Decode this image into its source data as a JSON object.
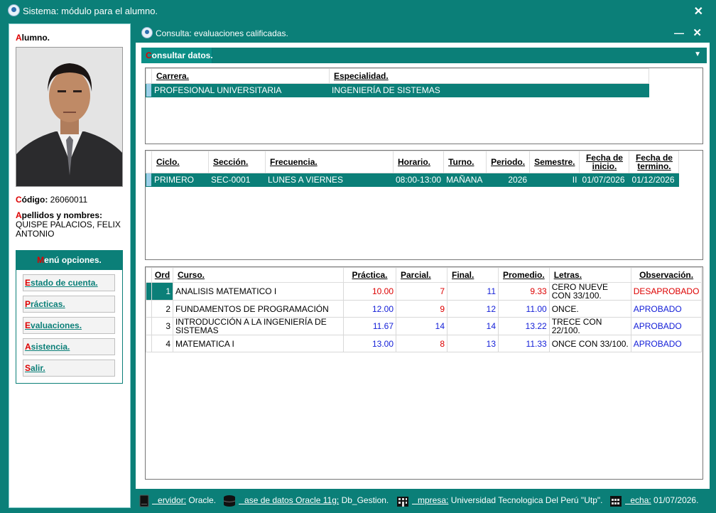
{
  "window": {
    "title": "Sistema: módulo para el alumno.",
    "close": "✕"
  },
  "student": {
    "alumno_label": "Alumno.",
    "codigo_label": "Código:",
    "codigo_value": "26060011",
    "apellidos_label": "Apellidos y nombres:",
    "apellidos_value": "QUISPE PALACIOS, FELIX ANTONIO"
  },
  "menu": {
    "title": "Menú opciones.",
    "items": [
      {
        "label": "Estado de cuenta."
      },
      {
        "label": "Prácticas."
      },
      {
        "label": "Evaluaciones."
      },
      {
        "label": "Asistencia."
      },
      {
        "label": "Salir."
      }
    ]
  },
  "inner": {
    "title": "Consulta: evaluaciones calificadas.",
    "minimize": "—",
    "close": "✕",
    "section": "Consultar datos.",
    "dropdown": "▼"
  },
  "carrera_table": {
    "headers": [
      "Carrera.",
      "Especialidad."
    ],
    "row": [
      "PROFESIONAL UNIVERSITARIA",
      "INGENIERÍA DE SISTEMAS"
    ]
  },
  "ciclo_table": {
    "headers": [
      "Ciclo.",
      "Sección.",
      "Frecuencia.",
      "Horario.",
      "Turno.",
      "Periodo.",
      "Semestre.",
      "Fecha de inicio.",
      "Fecha de termino."
    ],
    "row": [
      "PRIMERO",
      "SEC-0001",
      "LUNES A VIERNES",
      "08:00-13:00",
      "MAÑANA",
      "2026",
      "II",
      "01/07/2026",
      "01/12/2026"
    ]
  },
  "notes_table": {
    "headers": [
      "Ord",
      "Curso.",
      "Práctica.",
      "Parcial.",
      "Final.",
      "Promedio.",
      "Letras.",
      "Observación."
    ],
    "rows": [
      {
        "ord": "1",
        "curso": "ANALISIS MATEMATICO I",
        "practica": "10.00",
        "parcial": "7",
        "final": "11",
        "promedio": "9.33",
        "letras": "CERO NUEVE CON 33/100.",
        "observacion": "DESAPROBADO"
      },
      {
        "ord": "2",
        "curso": "FUNDAMENTOS DE PROGRAMACIÓN",
        "practica": "12.00",
        "parcial": "9",
        "final": "12",
        "promedio": "11.00",
        "letras": "ONCE.",
        "observacion": "APROBADO"
      },
      {
        "ord": "3",
        "curso": "INTRODUCCIÓN A LA INGENIERÍA DE SISTEMAS",
        "practica": "11.67",
        "parcial": "14",
        "final": "14",
        "promedio": "13.22",
        "letras": "TRECE CON 22/100.",
        "observacion": "APROBADO"
      },
      {
        "ord": "4",
        "curso": "MATEMATICA I",
        "practica": "13.00",
        "parcial": "8",
        "final": "13",
        "promedio": "11.33",
        "letras": "ONCE CON 33/100.",
        "observacion": "APROBADO"
      }
    ]
  },
  "status": {
    "servidor_label": "Servidor:",
    "servidor_value": "Oracle.",
    "bd_label": "Base de datos Oracle 11g:",
    "bd_value": "Db_Gestion.",
    "empresa_label": "Empresa:",
    "empresa_value": "Universidad Tecnologica Del Perú \"Utp\".",
    "fecha_label": "Fecha:",
    "fecha_value": "01/07/2026."
  },
  "colors": {
    "primary": "#0b7f78",
    "hotkey": "#dd0000",
    "fail": "#dd0000",
    "pass": "#1520d8"
  }
}
